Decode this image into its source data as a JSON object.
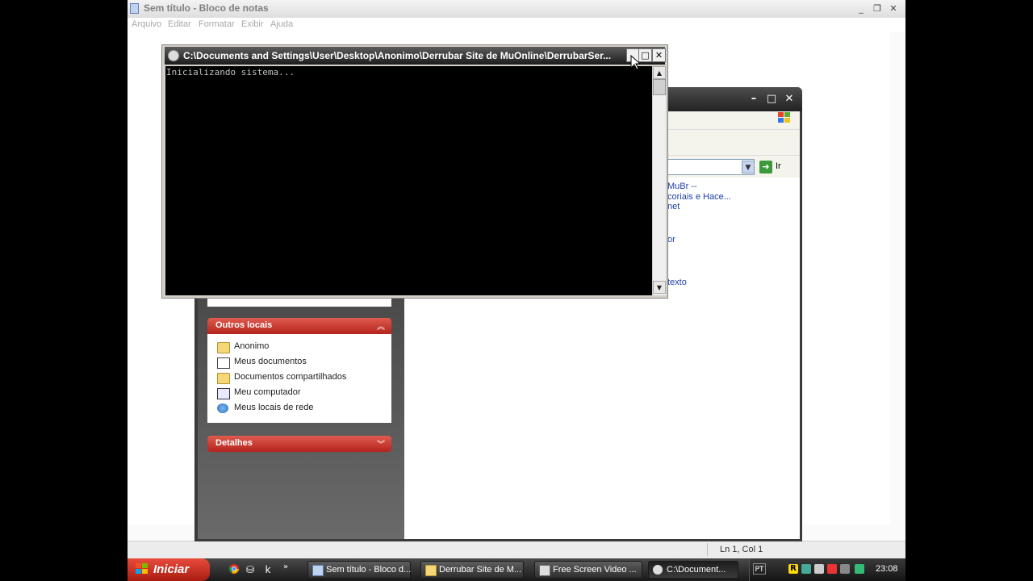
{
  "notepad": {
    "title": "Sem título - Bloco de notas",
    "menu": [
      "Arquivo",
      "Editar",
      "Formatar",
      "Exibir",
      "Ajuda"
    ],
    "status": "Ln 1, Col 1"
  },
  "explorer": {
    "address_go": "Ir",
    "content_links": [
      "MuBr --",
      "coriais e Hace...",
      "net",
      "or",
      "texto"
    ],
    "other_places": {
      "header": "Outros locais",
      "items": [
        {
          "label": "Anonimo",
          "icon": "folder-icon"
        },
        {
          "label": "Meus documentos",
          "icon": "documents-icon"
        },
        {
          "label": "Documentos compartilhados",
          "icon": "folder-icon"
        },
        {
          "label": "Meu computador",
          "icon": "computer-icon"
        },
        {
          "label": "Meus locais de rede",
          "icon": "network-icon"
        }
      ]
    },
    "details": {
      "header": "Detalhes"
    }
  },
  "cmd": {
    "title": "C:\\Documents and Settings\\User\\Desktop\\Anonimo\\Derrubar Site de MuOnline\\DerrubarSer...",
    "output": "Inicializando sistema..."
  },
  "taskbar": {
    "start_label": "Iniciar",
    "tasks": [
      {
        "label": "Sem título - Bloco d...",
        "icon": "notepad-icon",
        "active": false
      },
      {
        "label": "Derrubar Site de M...",
        "icon": "folder-icon",
        "active": false
      },
      {
        "label": "Free Screen Video ...",
        "icon": "recorder-icon",
        "active": false
      },
      {
        "label": "C:\\Document...",
        "icon": "cmd-icon",
        "active": true
      }
    ],
    "language": "PT",
    "clock": "23:08"
  }
}
